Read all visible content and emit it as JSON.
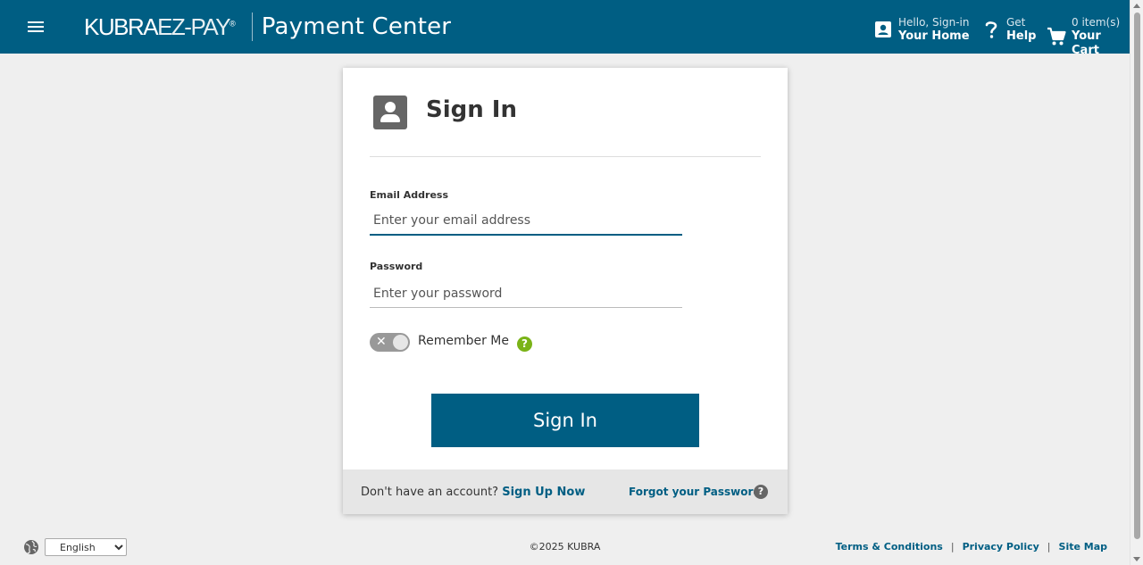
{
  "header": {
    "logo_primary": "KUBRA",
    "logo_secondary": "EZ-PAY",
    "logo_mark": "®",
    "title": "Payment Center",
    "home": {
      "small": "Hello, Sign-in",
      "big": "Your Home",
      "icon": "account-box-icon"
    },
    "help": {
      "small": "Get",
      "big": "Help",
      "icon": "question-mark-icon"
    },
    "cart": {
      "small": "0 item(s)",
      "big": "Your Cart",
      "icon": "shopping-cart-icon"
    }
  },
  "signin": {
    "title": "Sign In",
    "email_label": "Email Address",
    "email_placeholder": "Enter your email address",
    "email_value": "",
    "password_label": "Password",
    "password_placeholder": "Enter your password",
    "password_value": "",
    "remember_label": "Remember Me",
    "remember_on": false,
    "remember_help": "?",
    "button_label": "Sign In"
  },
  "card_footer": {
    "no_account_text": "Don't have an account?",
    "signup_label": "Sign Up Now",
    "forgot_label": "Forgot your Password?",
    "forgot_help": "?"
  },
  "footer": {
    "language_selected": "English",
    "copyright": "©2025 KUBRA",
    "links": [
      "Terms & Conditions",
      "Privacy Policy",
      "Site Map"
    ],
    "separator": "|"
  },
  "colors": {
    "brand": "#005e83",
    "help_green": "#7ab317",
    "background": "#efefef"
  }
}
